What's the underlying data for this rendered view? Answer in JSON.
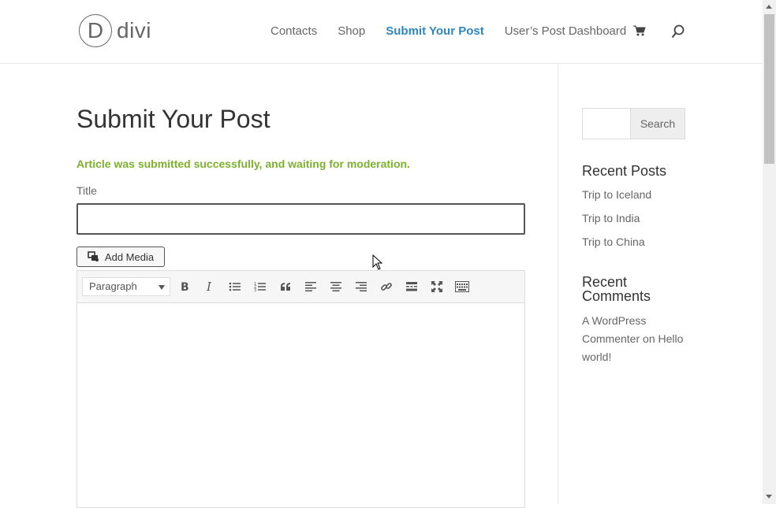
{
  "header": {
    "logo_letter": "D",
    "logo_text": "divi",
    "nav": [
      {
        "label": "Contacts"
      },
      {
        "label": "Shop"
      },
      {
        "label": "Submit Your Post"
      },
      {
        "label": "User’s Post Dashboard"
      }
    ],
    "accent_color": "#2e86c1"
  },
  "main": {
    "page_title": "Submit Your Post",
    "notice": "Article was submitted successfully, and waiting for moderation.",
    "notice_color": "#7cb12d",
    "title_label": "Title",
    "title_value": "",
    "add_media_label": "Add Media",
    "format_select_value": "Paragraph",
    "toolbar_icons": [
      "bold-icon",
      "italic-icon",
      "bullet-list-icon",
      "numbered-list-icon",
      "blockquote-icon",
      "align-left-icon",
      "align-center-icon",
      "align-right-icon",
      "link-icon",
      "read-more-icon",
      "fullscreen-icon",
      "toolbar-toggle-icon"
    ]
  },
  "sidebar": {
    "search_button": "Search",
    "recent_posts_title": "Recent Posts",
    "recent_posts": [
      "Trip to Iceland",
      "Trip to India",
      "Trip to China"
    ],
    "recent_comments_title_line1": "Recent",
    "recent_comments_title_line2": "Comments",
    "comment_author": "A WordPress Commenter",
    "comment_on": "on",
    "comment_post": "Hello world!"
  }
}
